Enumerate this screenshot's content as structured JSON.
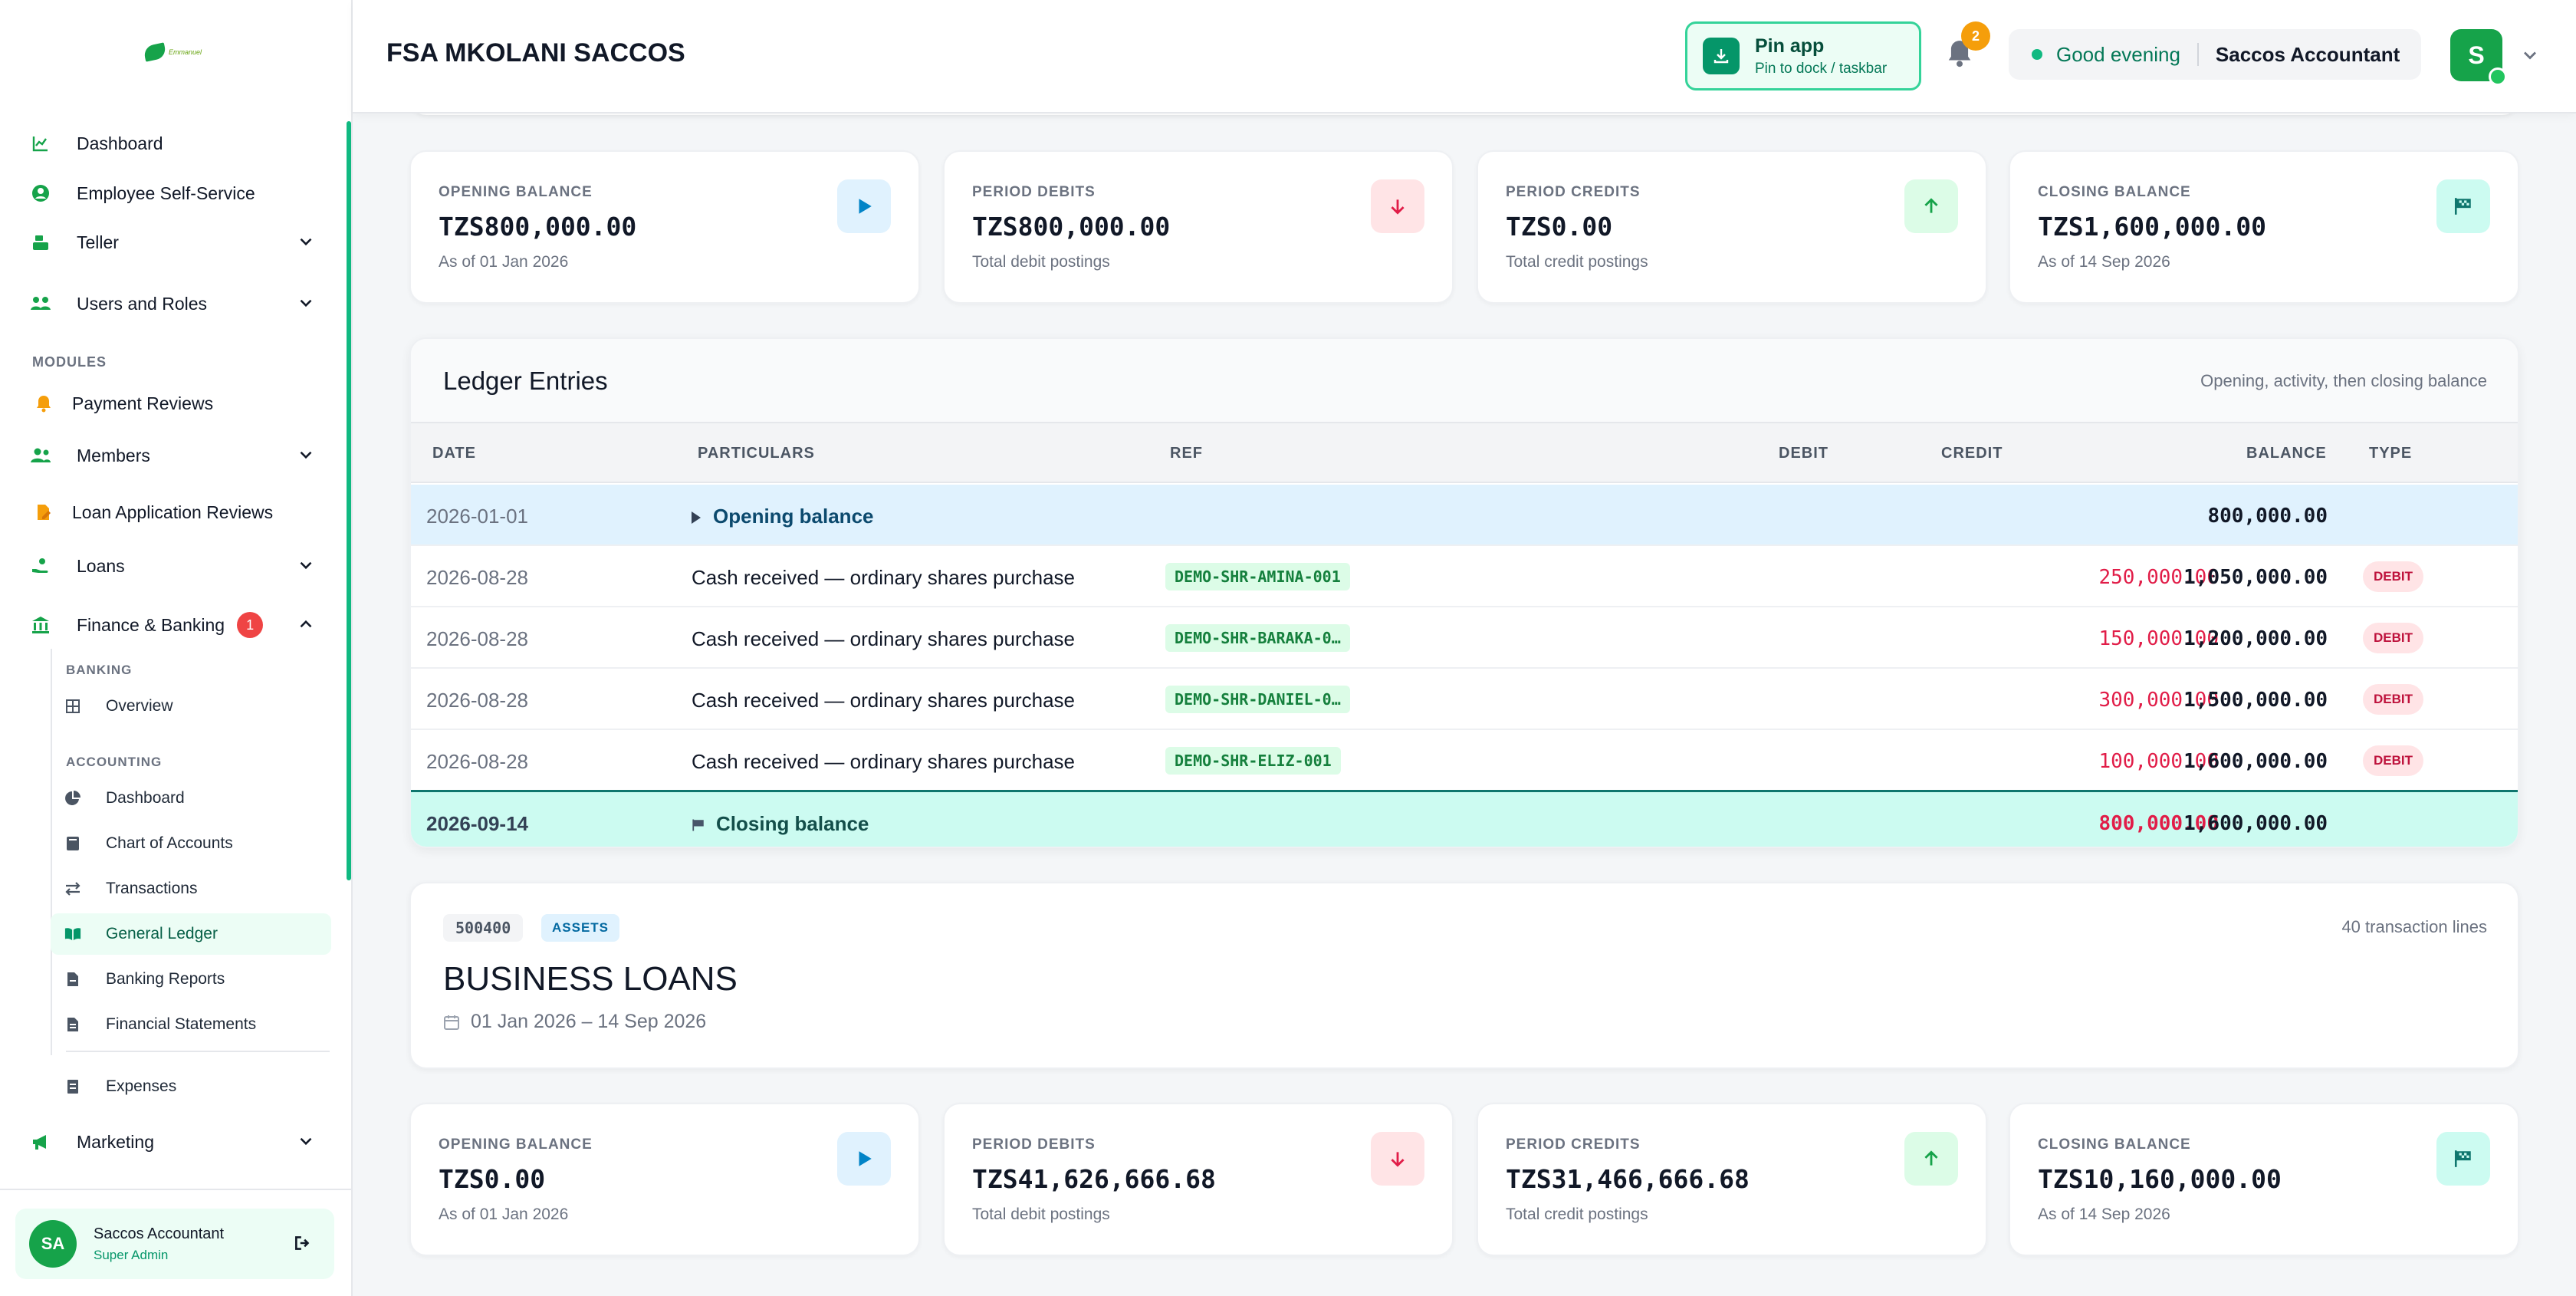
{
  "header": {
    "org_title": "FSA MKOLANI SACCOS",
    "pin_title": "Pin app",
    "pin_sub": "Pin to dock / taskbar",
    "notification_count": "2",
    "greeting": "Good evening",
    "user_role": "Saccos Accountant",
    "avatar_initial": "S"
  },
  "sidebar": {
    "logo_text": "Emmanuel",
    "top_items": [
      {
        "label": "Dashboard"
      },
      {
        "label": "Employee Self-Service"
      },
      {
        "label": "Teller"
      },
      {
        "label": "Users and Roles"
      }
    ],
    "modules_label": "MODULES",
    "module_items": [
      {
        "label": "Payment Reviews"
      },
      {
        "label": "Members"
      },
      {
        "label": "Loan Application Reviews"
      },
      {
        "label": "Loans"
      },
      {
        "label": "Finance & Banking",
        "badge": "1"
      }
    ],
    "banking_label": "BANKING",
    "banking_items": [
      {
        "label": "Overview"
      }
    ],
    "accounting_label": "ACCOUNTING",
    "accounting_items": [
      {
        "label": "Dashboard"
      },
      {
        "label": "Chart of Accounts"
      },
      {
        "label": "Transactions"
      },
      {
        "label": "General Ledger"
      },
      {
        "label": "Banking Reports"
      },
      {
        "label": "Financial Statements"
      }
    ],
    "other_items": [
      {
        "label": "Expenses"
      },
      {
        "label": "Marketing"
      }
    ],
    "user": {
      "initials": "SA",
      "name": "Saccos Accountant",
      "role": "Super Admin"
    }
  },
  "summary_1": [
    {
      "label": "OPENING BALANCE",
      "value": "TZS800,000.00",
      "sub": "As of 01 Jan 2026"
    },
    {
      "label": "PERIOD DEBITS",
      "value": "TZS800,000.00",
      "sub": "Total debit postings"
    },
    {
      "label": "PERIOD CREDITS",
      "value": "TZS0.00",
      "sub": "Total credit postings"
    },
    {
      "label": "CLOSING BALANCE",
      "value": "TZS1,600,000.00",
      "sub": "As of 14 Sep 2026"
    }
  ],
  "ledger": {
    "title": "Ledger Entries",
    "hint": "Opening, activity, then closing balance",
    "columns": {
      "date": "DATE",
      "particulars": "PARTICULARS",
      "ref": "REF",
      "debit": "DEBIT",
      "credit": "CREDIT",
      "balance": "BALANCE",
      "type": "TYPE"
    },
    "opening": {
      "date": "2026-01-01",
      "label": "Opening balance",
      "balance": "800,000.00"
    },
    "rows": [
      {
        "date": "2026-08-28",
        "particulars": "Cash received — ordinary shares purchase",
        "ref": "DEMO-SHR-AMINA-001",
        "debit": "250,000.00",
        "balance": "1,050,000.00",
        "type": "DEBIT"
      },
      {
        "date": "2026-08-28",
        "particulars": "Cash received — ordinary shares purchase",
        "ref": "DEMO-SHR-BARAKA-0…",
        "debit": "150,000.00",
        "balance": "1,200,000.00",
        "type": "DEBIT"
      },
      {
        "date": "2026-08-28",
        "particulars": "Cash received — ordinary shares purchase",
        "ref": "DEMO-SHR-DANIEL-0…",
        "debit": "300,000.00",
        "balance": "1,500,000.00",
        "type": "DEBIT"
      },
      {
        "date": "2026-08-28",
        "particulars": "Cash received — ordinary shares purchase",
        "ref": "DEMO-SHR-ELIZ-001",
        "debit": "100,000.00",
        "balance": "1,600,000.00",
        "type": "DEBIT"
      }
    ],
    "closing": {
      "date": "2026-09-14",
      "label": "Closing balance",
      "debit": "800,000.00",
      "balance": "1,600,000.00"
    }
  },
  "account": {
    "code": "500400",
    "category": "ASSETS",
    "name": "BUSINESS LOANS",
    "range": "01 Jan 2026 – 14 Sep 2026",
    "count": "40 transaction lines"
  },
  "summary_2": [
    {
      "label": "OPENING BALANCE",
      "value": "TZS0.00",
      "sub": "As of 01 Jan 2026"
    },
    {
      "label": "PERIOD DEBITS",
      "value": "TZS41,626,666.68",
      "sub": "Total debit postings"
    },
    {
      "label": "PERIOD CREDITS",
      "value": "TZS31,466,666.68",
      "sub": "Total credit postings"
    },
    {
      "label": "CLOSING BALANCE",
      "value": "TZS10,160,000.00",
      "sub": "As of 14 Sep 2026"
    }
  ],
  "colors": {
    "brand": "#16a34a",
    "debit": "#e11d48",
    "opening_row": "#e0f2fe",
    "closing_row": "#ccfbf1"
  }
}
